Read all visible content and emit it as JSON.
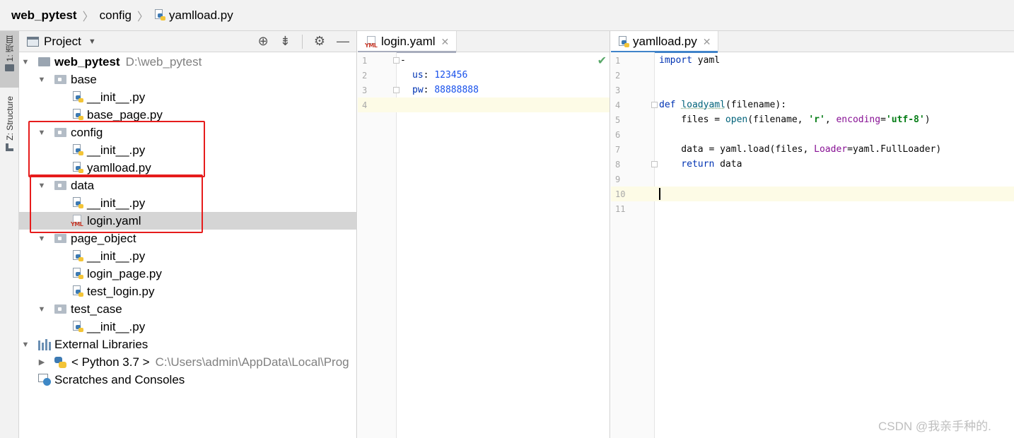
{
  "breadcrumb": {
    "project": "web_pytest",
    "folder": "config",
    "file": "yamlload.py"
  },
  "toolstrip": {
    "project_label": "1: 项目",
    "structure_label": "Z: Structure"
  },
  "project_panel": {
    "title": "Project",
    "tree": {
      "root": {
        "name": "web_pytest",
        "path": "D:\\web_pytest"
      },
      "base": "base",
      "base_init": "__init__.py",
      "base_page": "base_page.py",
      "config": "config",
      "config_init": "__init__.py",
      "config_yamlload": "yamlload.py",
      "data": "data",
      "data_init": "__init__.py",
      "data_login": "login.yaml",
      "page_object": "page_object",
      "po_init": "__init__.py",
      "po_login_page": "login_page.py",
      "po_test_login": "test_login.py",
      "test_case": "test_case",
      "tc_init": "__init__.py",
      "external_libraries": "External Libraries",
      "python": {
        "name": "< Python 3.7 >",
        "path": "C:\\Users\\admin\\AppData\\Local\\Prog"
      },
      "scratches": "Scratches and Consoles"
    }
  },
  "editor_yaml": {
    "tab_label": "login.yaml",
    "lines": {
      "l1_no": "1",
      "l1_dash": "-",
      "l2_no": "2",
      "l2_key": "us",
      "l2_val": "123456",
      "l3_no": "3",
      "l3_key": "pw",
      "l3_val": "88888888",
      "l4_no": "4"
    }
  },
  "editor_py": {
    "tab_label": "yamlload.py",
    "lines": {
      "l1_no": "1",
      "l1_kw": "import",
      "l1_mod": " yaml",
      "l2_no": "2",
      "l3_no": "3",
      "l4_no": "4",
      "l4_kw": "def",
      "l4_name": "loadyaml",
      "l4_rest": "(filename):",
      "l5_no": "5",
      "l5_a": "    files = ",
      "l5_fn": "open",
      "l5_b": "(filename, ",
      "l5_s1": "'r'",
      "l5_c": ", ",
      "l5_p": "encoding",
      "l5_d": "=",
      "l5_s2": "'utf-8'",
      "l5_e": ")",
      "l6_no": "6",
      "l7_no": "7",
      "l7_a": "    data = yaml.load(files, ",
      "l7_p": "Loader",
      "l7_b": "=yaml.FullLoader)",
      "l8_no": "8",
      "l8_kw": "    return",
      "l8_rest": " data",
      "l9_no": "9",
      "l10_no": "10",
      "l11_no": "11"
    }
  },
  "watermark": "CSDN @我亲手种的.",
  "colors": {
    "highlight_box": "#e61c1c",
    "selected_row": "#d5d5d5",
    "tab_underline_active": "#4083c9",
    "tab_underline_inactive": "#a8adbd"
  }
}
